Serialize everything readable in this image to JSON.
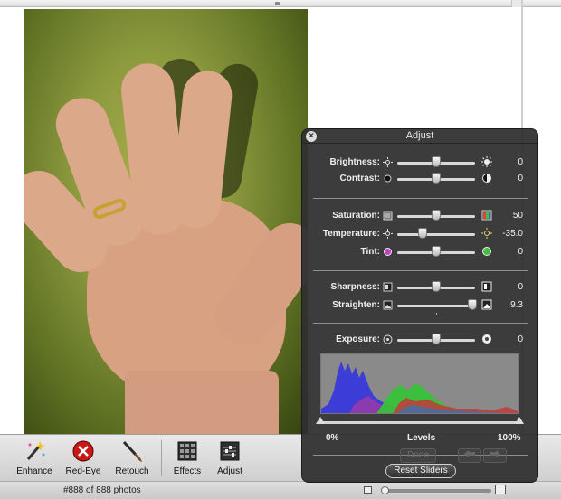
{
  "status": {
    "photo_count": "#888 of 888 photos"
  },
  "toolbar": {
    "enhance": "Enhance",
    "red_eye": "Red-Eye",
    "retouch": "Retouch",
    "effects": "Effects",
    "adjust": "Adjust"
  },
  "hud": {
    "title": "Adjust",
    "brightness": {
      "label": "Brightness:",
      "value": "0",
      "level": 0.5
    },
    "contrast": {
      "label": "Contrast:",
      "value": "0",
      "level": 0.5
    },
    "saturation": {
      "label": "Saturation:",
      "value": "50",
      "level": 0.5
    },
    "temperature": {
      "label": "Temperature:",
      "value": "-35.0",
      "level": 0.33
    },
    "tint": {
      "label": "Tint:",
      "value": "0",
      "level": 0.5
    },
    "sharpness": {
      "label": "Sharpness:",
      "value": "0",
      "level": 0.5
    },
    "straighten": {
      "label": "Straighten:",
      "value": "9.3",
      "level": 0.96
    },
    "exposure": {
      "label": "Exposure:",
      "value": "0",
      "level": 0.5
    },
    "levels": {
      "label": "Levels",
      "min_label": "0%",
      "max_label": "100%"
    },
    "done_label": "Done",
    "reset_label": "Reset Sliders"
  },
  "colors": {
    "hud_bg": "#303030",
    "accent_red": "#d42020"
  },
  "icons": [
    "close-icon",
    "sun-small-icon",
    "sun-large-icon",
    "contrast-icon",
    "saturation-icon",
    "tint-icon",
    "sharpness-icon",
    "straighten-icon",
    "exposure-icon",
    "enhance-wand-icon",
    "red-eye-icon",
    "retouch-brush-icon",
    "effects-grid-icon",
    "adjust-sliders-icon"
  ]
}
